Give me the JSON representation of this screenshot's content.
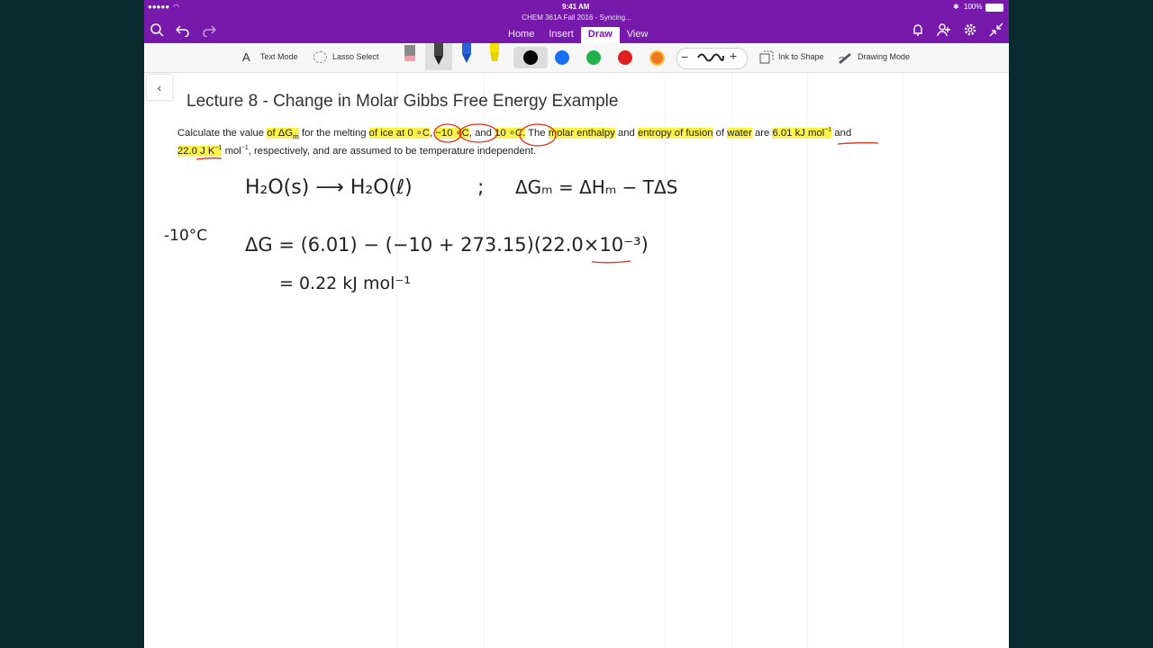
{
  "status": {
    "carrier": "●●●●● ",
    "time": "9:41 AM",
    "battery": "100%"
  },
  "document": {
    "title": "CHEM 361A Fall 2016 - Syncing..."
  },
  "tabs": [
    {
      "label": "Home",
      "active": false
    },
    {
      "label": "Insert",
      "active": false
    },
    {
      "label": "Draw",
      "active": true
    },
    {
      "label": "View",
      "active": false
    }
  ],
  "toolbar": {
    "text_mode": "Text Mode",
    "lasso_select": "Lasso Select",
    "ink_to_shape": "Ink to Shape",
    "drawing_mode": "Drawing Mode",
    "colors": [
      "#000000",
      "#1a6ef0",
      "#22b14c",
      "#e02020",
      "#f07820"
    ]
  },
  "page": {
    "title": "Lecture 8 - Change in Molar Gibbs Free Energy Example",
    "problem": {
      "p1": "Calculate the value ",
      "h1": "of ΔG",
      "h1sub": "m",
      "p2": " for the melting ",
      "h2": "of ice at ",
      "h3": "0 ∘C",
      "p3": ", ",
      "h4": "−10 ∘C",
      "p4": ", and ",
      "h5": "10 ∘C.",
      "p5": " The ",
      "h6": "molar enthalpy",
      "p6": " and ",
      "h7": "entropy of fusion",
      "p7": " of ",
      "h8": "water",
      "p8": " are ",
      "h9": "6.01 kJ mol",
      "h9sup": "−1",
      "p9": " and",
      "h10": "22.0 J K",
      "h10sup": "−1",
      "h10b": " mol",
      "h10bsup": "−1",
      "p10": ", respectively, and are assumed to be temperature independent."
    },
    "handwriting": {
      "line1_left": "H₂O(s) ⟶ H₂O(ℓ)",
      "line1_sep": ";",
      "line1_right": "ΔGₘ = ΔHₘ − TΔS",
      "temp": "-10°C",
      "line2": "ΔG = (6.01) − (−10 + 273.15)(22.0×10⁻³)",
      "line3": "= 0.22 kJ mol⁻¹"
    }
  }
}
